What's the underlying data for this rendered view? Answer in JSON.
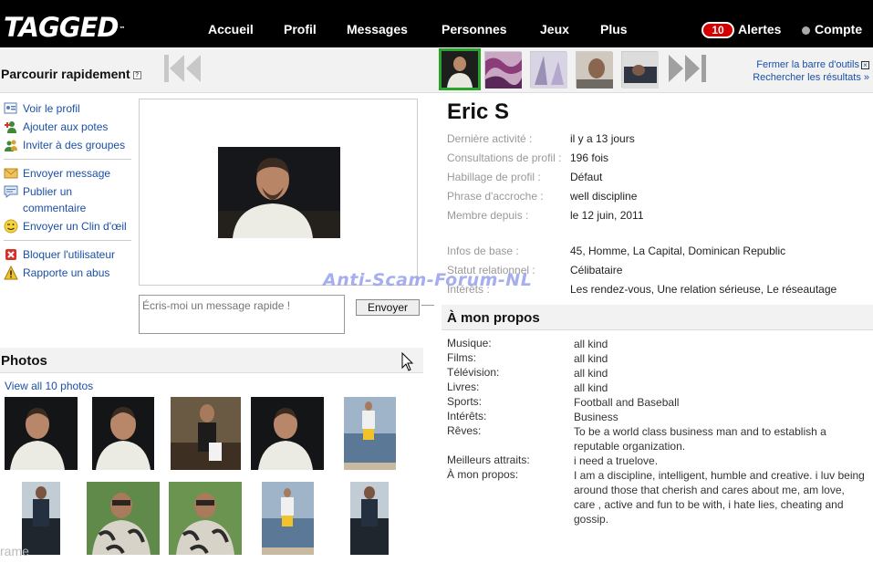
{
  "brand": {
    "logo": "TAGGED",
    "tm": "™"
  },
  "nav": {
    "items": [
      "Accueil",
      "Profil",
      "Messages",
      "Personnes",
      "Jeux",
      "Plus"
    ],
    "alerts_count": "10",
    "alerts_label": "Alertes",
    "account_label": "Compte"
  },
  "browse": {
    "title": "Parcourir rapidement",
    "help": "?",
    "close_toolbar": "Fermer la barre d'outils",
    "search_results": "Rechercher les résultats »"
  },
  "actions": {
    "view_profile": "Voir le profil",
    "add_friends": "Ajouter aux potes",
    "invite_groups": "Inviter à des groupes",
    "send_message": "Envoyer message",
    "post_comment": "Publier un commentaire",
    "send_wink": "Envoyer un Clin d'œil",
    "block_user": "Bloquer l'utilisateur",
    "report_abuse": "Rapporte un abus"
  },
  "quick_message": {
    "placeholder": "Écris-moi un message rapide !",
    "send": "Envoyer"
  },
  "photos": {
    "title": "Photos",
    "view_all": "View all 10 photos",
    "caption_fragment": "rame"
  },
  "profile": {
    "name": "Eric S",
    "rows": [
      {
        "label": "Dernière activité :",
        "value": "il y a 13 jours"
      },
      {
        "label": "Consultations de profil :",
        "value": "196 fois"
      },
      {
        "label": "Habillage de profil :",
        "value": "Défaut"
      },
      {
        "label": "Phrase d'accroche :",
        "value": "well discipline"
      },
      {
        "label": "Membre depuis :",
        "value": "le 12 juin, 2011"
      }
    ],
    "basic_rows": [
      {
        "label": "Infos de base :",
        "value": "45, Homme, La Capital, Dominican Republic"
      },
      {
        "label": "Statut relationnel :",
        "value": "Célibataire"
      },
      {
        "label": "Intérêts :",
        "value": "Les rendez-vous, Une relation sérieuse, Le réseautage"
      }
    ]
  },
  "about": {
    "title": "À mon propos",
    "items": [
      {
        "label": "Musique:",
        "value": "all kind"
      },
      {
        "label": "Films:",
        "value": "all kind"
      },
      {
        "label": "Télévision:",
        "value": "all kind"
      },
      {
        "label": "Livres:",
        "value": "all kind"
      },
      {
        "label": "Sports:",
        "value": "Football and Baseball"
      },
      {
        "label": "Intérêts:",
        "value": "Business"
      },
      {
        "label": "Rêves:",
        "value": "To be a world class business man and to establish a reputable organization."
      },
      {
        "label": "Meilleurs attraits:",
        "value": "i need a truelove."
      },
      {
        "label": "À mon propos:",
        "value": "I am a discipline, intelligent, humble and creative. i luv being around those that cherish and cares about me, am love, care , active and fun to be with, i hate lies, cheating and gossip."
      }
    ]
  },
  "watermark": "Anti-Scam-Forum-NL"
}
